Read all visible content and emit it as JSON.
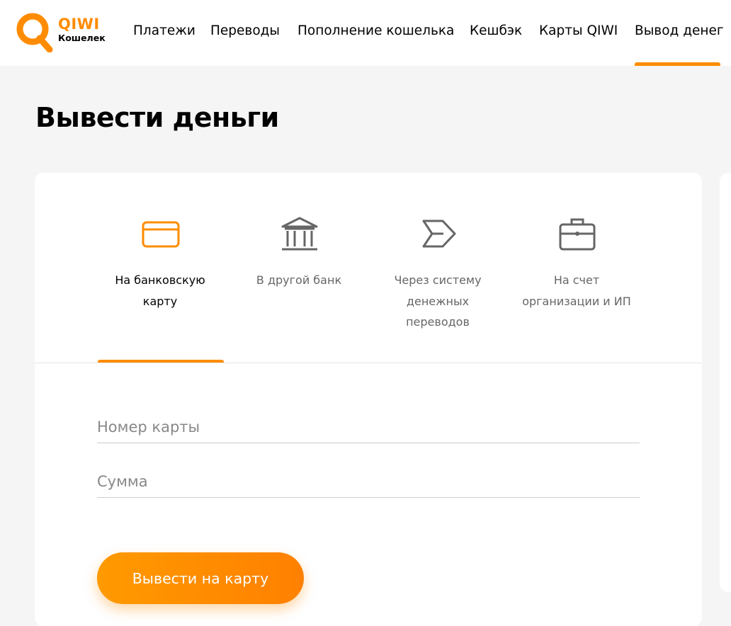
{
  "brand": {
    "name": "QIWI",
    "subtitle": "Кошелек",
    "color": "#ff8c00"
  },
  "nav": {
    "items": [
      {
        "label": "Платежи"
      },
      {
        "label": "Переводы"
      },
      {
        "label": "Пополнение кошелька"
      },
      {
        "label": "Кешбэк"
      },
      {
        "label": "Карты QIWI"
      },
      {
        "label": "Вывод денег",
        "active": true
      }
    ]
  },
  "page": {
    "title": "Вывести деньги"
  },
  "tabs": [
    {
      "label": "На банковскую карту",
      "icon": "credit-card-icon",
      "active": true
    },
    {
      "label": "В другой банк",
      "icon": "bank-building-icon"
    },
    {
      "label": "Через систему денежных переводов",
      "icon": "money-transfer-icon"
    },
    {
      "label": "На счет организации и ИП",
      "icon": "briefcase-icon"
    }
  ],
  "form": {
    "card_number": {
      "value": "",
      "placeholder": "Номер карты"
    },
    "amount": {
      "value": "",
      "placeholder": "Сумма"
    },
    "submit_label": "Вывести на карту"
  },
  "colors": {
    "accent": "#ff8c00",
    "icon_gray": "#666666",
    "background": "#f5f5f5"
  }
}
